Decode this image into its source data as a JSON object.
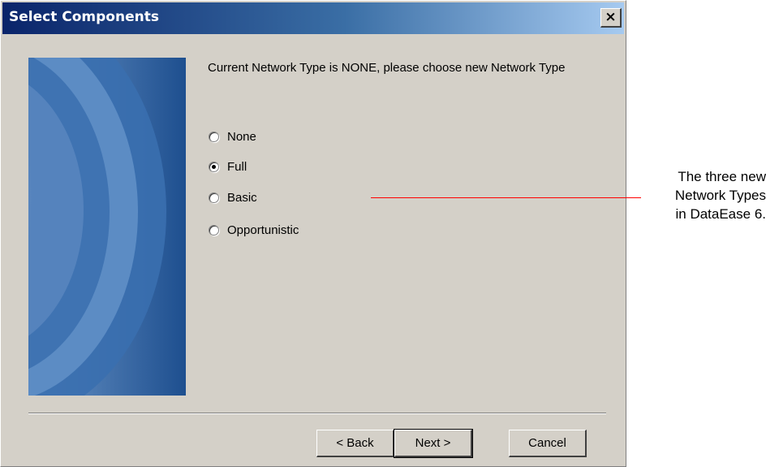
{
  "window": {
    "title": "Select Components",
    "close_label": "×"
  },
  "content": {
    "heading": "Current Network Type is NONE, please choose new Network Type",
    "options": [
      {
        "label": "None",
        "selected": false
      },
      {
        "label": "Full",
        "selected": true
      },
      {
        "label": "Basic",
        "selected": false
      },
      {
        "label": "Opportunistic",
        "selected": false
      }
    ]
  },
  "buttons": {
    "back": "< Back",
    "next": "Next >",
    "cancel": "Cancel"
  },
  "annotation": {
    "text_lines": [
      "The three new",
      "Network Types",
      "in DataEase 6."
    ],
    "line_color": "#ff0000"
  },
  "colors": {
    "dialog_bg": "#d4d0c8",
    "title_gradient_start": "#0a246a",
    "title_gradient_end": "#a6caf0",
    "side_image_blue": "#2e67a6"
  }
}
